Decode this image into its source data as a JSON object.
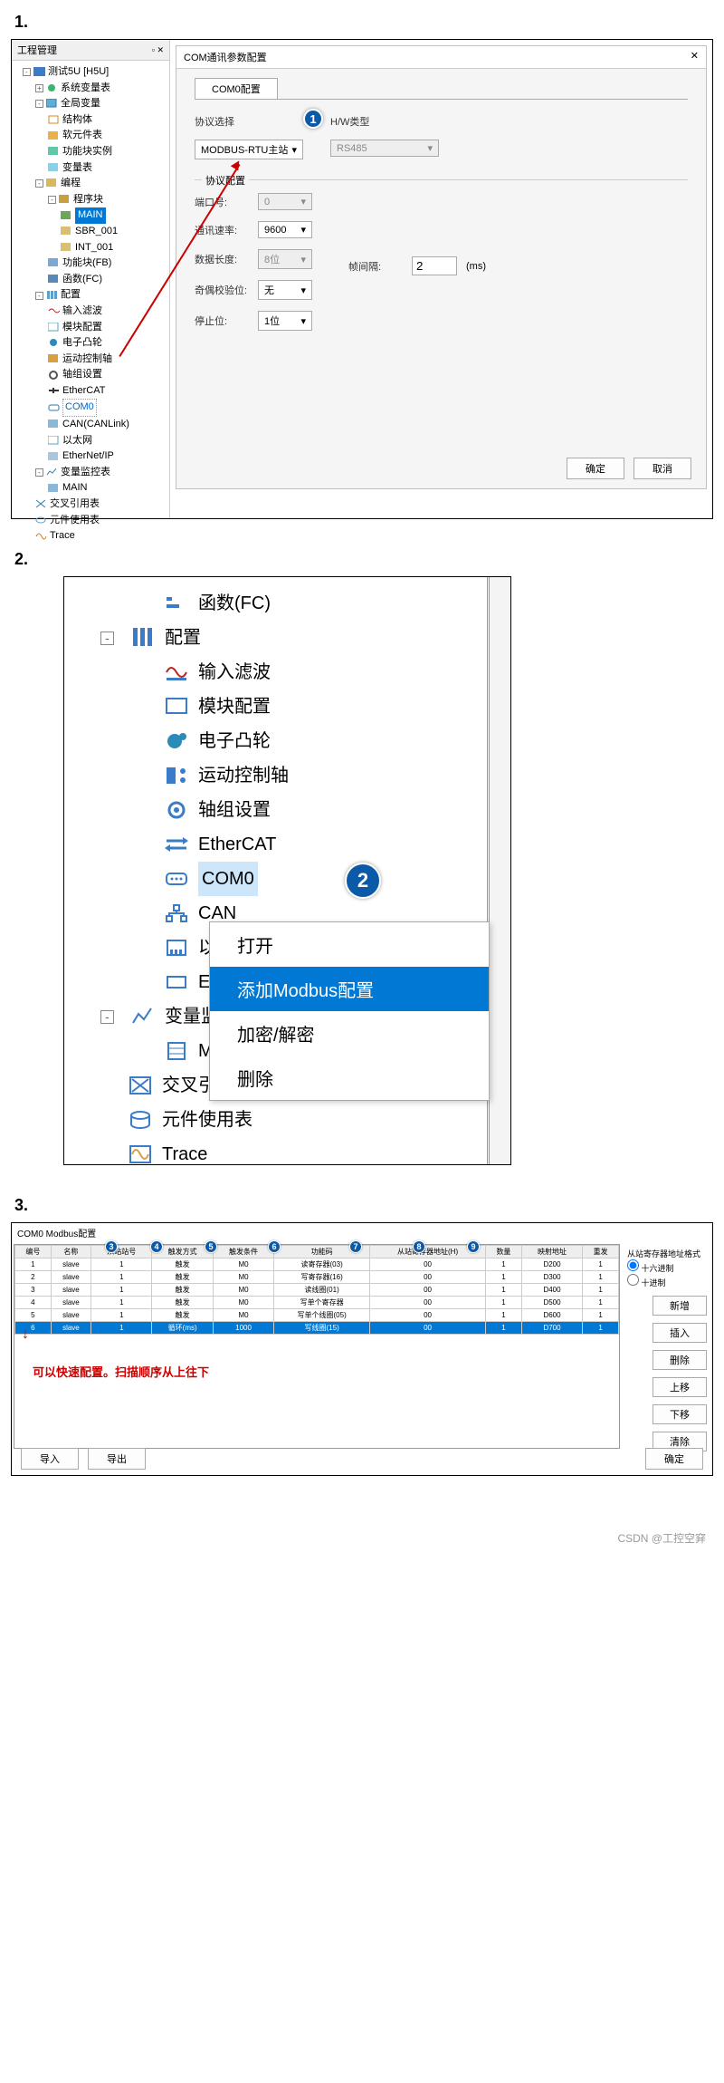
{
  "section_labels": {
    "s1": "1.",
    "s2": "2.",
    "s3": "3."
  },
  "s1": {
    "tree_title": "工程管理",
    "tree": {
      "root": "测试5U  [H5U]",
      "n1": "系统变量表",
      "n2": "全局变量",
      "n2_1": "结构体",
      "n2_2": "软元件表",
      "n2_3": "功能块实例",
      "n2_4": "变量表",
      "n3": "编程",
      "n3_1": "程序块",
      "n3_1_1": "MAIN",
      "n3_1_2": "SBR_001",
      "n3_1_3": "INT_001",
      "n3_2": "功能块(FB)",
      "n3_3": "函数(FC)",
      "n4": "配置",
      "n4_1": "输入滤波",
      "n4_2": "模块配置",
      "n4_3": "电子凸轮",
      "n4_4": "运动控制轴",
      "n4_5": "轴组设置",
      "n4_6": "EtherCAT",
      "n4_7": "COM0",
      "n4_8": "CAN(CANLink)",
      "n4_9": "以太网",
      "n4_10": "EtherNet/IP",
      "n5": "变量监控表",
      "n5_1": "MAIN",
      "n6": "交叉引用表",
      "n7": "元件使用表",
      "n8": "Trace"
    },
    "dialog": {
      "title": "COM通讯参数配置",
      "tab": "COM0配置",
      "proto_label": "协议选择",
      "proto_value": "MODBUS-RTU主站",
      "hw_label": "H/W类型",
      "hw_value": "RS485",
      "proto_cfg": "协议配置",
      "port_label": "端口号:",
      "port_value": "0",
      "baud_label": "通讯速率:",
      "baud_value": "9600",
      "data_label": "数据长度:",
      "data_value": "8位",
      "parity_label": "奇偶校验位:",
      "parity_value": "无",
      "stop_label": "停止位:",
      "stop_value": "1位",
      "interval_label": "帧间隔:",
      "interval_value": "2",
      "interval_unit": "(ms)",
      "ok": "确定",
      "cancel": "取消"
    }
  },
  "s2": {
    "items": {
      "fc": "函数(FC)",
      "cfg": "配置",
      "in_filter": "输入滤波",
      "module": "模块配置",
      "cam": "电子凸轮",
      "motion": "运动控制轴",
      "axis": "轴组设置",
      "ethercat": "EtherCAT",
      "com0": "COM0",
      "can": "CAN",
      "eth1": "以太网",
      "eth2": "Ether",
      "monitor": "变量监控表",
      "main": "MAIN",
      "xref": "交叉引用表",
      "usage": "元件使用表",
      "trace": "Trace"
    },
    "menu": {
      "open": "打开",
      "add": "添加Modbus配置",
      "enc": "加密/解密",
      "del": "删除"
    }
  },
  "s3": {
    "title": "COM0 Modbus配置",
    "headers": [
      "编号",
      "名称",
      "从站站号",
      "触发方式",
      "触发条件",
      "功能码",
      "从站寄存器地址(H)",
      "数量",
      "映射地址",
      "重发"
    ],
    "rows": [
      [
        "1",
        "slave",
        "1",
        "触发",
        "M0",
        "读寄存器(03)",
        "00",
        "1",
        "D200",
        "1"
      ],
      [
        "2",
        "slave",
        "1",
        "触发",
        "M0",
        "写寄存器(16)",
        "00",
        "1",
        "D300",
        "1"
      ],
      [
        "3",
        "slave",
        "1",
        "触发",
        "M0",
        "读线圈(01)",
        "00",
        "1",
        "D400",
        "1"
      ],
      [
        "4",
        "slave",
        "1",
        "触发",
        "M0",
        "写单个寄存器",
        "00",
        "1",
        "D500",
        "1"
      ],
      [
        "5",
        "slave",
        "1",
        "触发",
        "M0",
        "写单个线圈(05)",
        "00",
        "1",
        "D600",
        "1"
      ],
      [
        "6",
        "slave",
        "1",
        "循环(ms)",
        "1000",
        "写线圈(15)",
        "00",
        "1",
        "D700",
        "1"
      ]
    ],
    "right": {
      "group_label": "从站寄存器地址格式",
      "hex": "十六进制",
      "dec": "十进制",
      "new": "新增",
      "ins": "插入",
      "del": "删除",
      "up": "上移",
      "down": "下移",
      "clear": "清除"
    },
    "import": "导入",
    "export": "导出",
    "ok": "确定",
    "note": "可以快速配置。扫描顺序从上往下"
  },
  "footer": "CSDN @工控空穽"
}
